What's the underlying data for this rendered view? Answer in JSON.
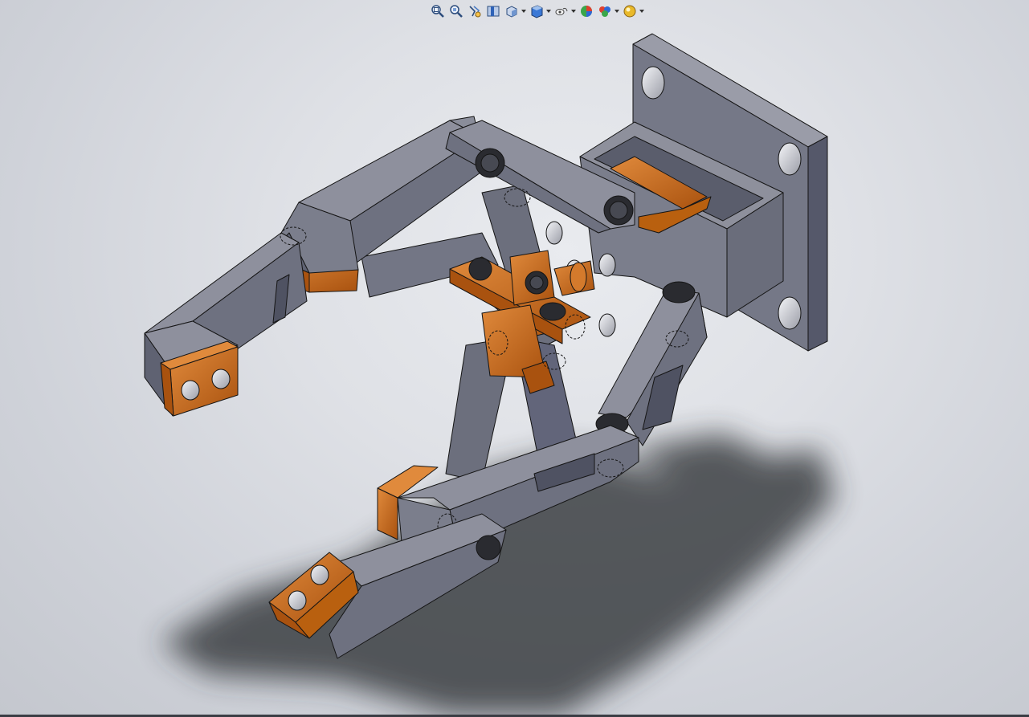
{
  "window": {
    "title": ""
  },
  "toolbar": {
    "buttons": [
      {
        "icon": "zoom-to-fit-icon"
      },
      {
        "icon": "zoom-to-area-icon"
      },
      {
        "icon": "previous-view-icon"
      },
      {
        "icon": "section-view-icon"
      },
      {
        "icon": "view-orientation-icon",
        "has_dropdown": true
      },
      {
        "icon": "display-style-icon",
        "has_dropdown": true
      },
      {
        "icon": "hide-show-items-icon",
        "has_dropdown": true
      },
      {
        "icon": "edit-appearance-icon"
      },
      {
        "icon": "apply-scene-icon",
        "has_dropdown": true
      },
      {
        "icon": "view-settings-icon",
        "has_dropdown": true
      }
    ]
  },
  "model": {
    "part_color": "#6f7280",
    "accent_color": "#c8651c",
    "background_color": "#dfe1e6"
  }
}
